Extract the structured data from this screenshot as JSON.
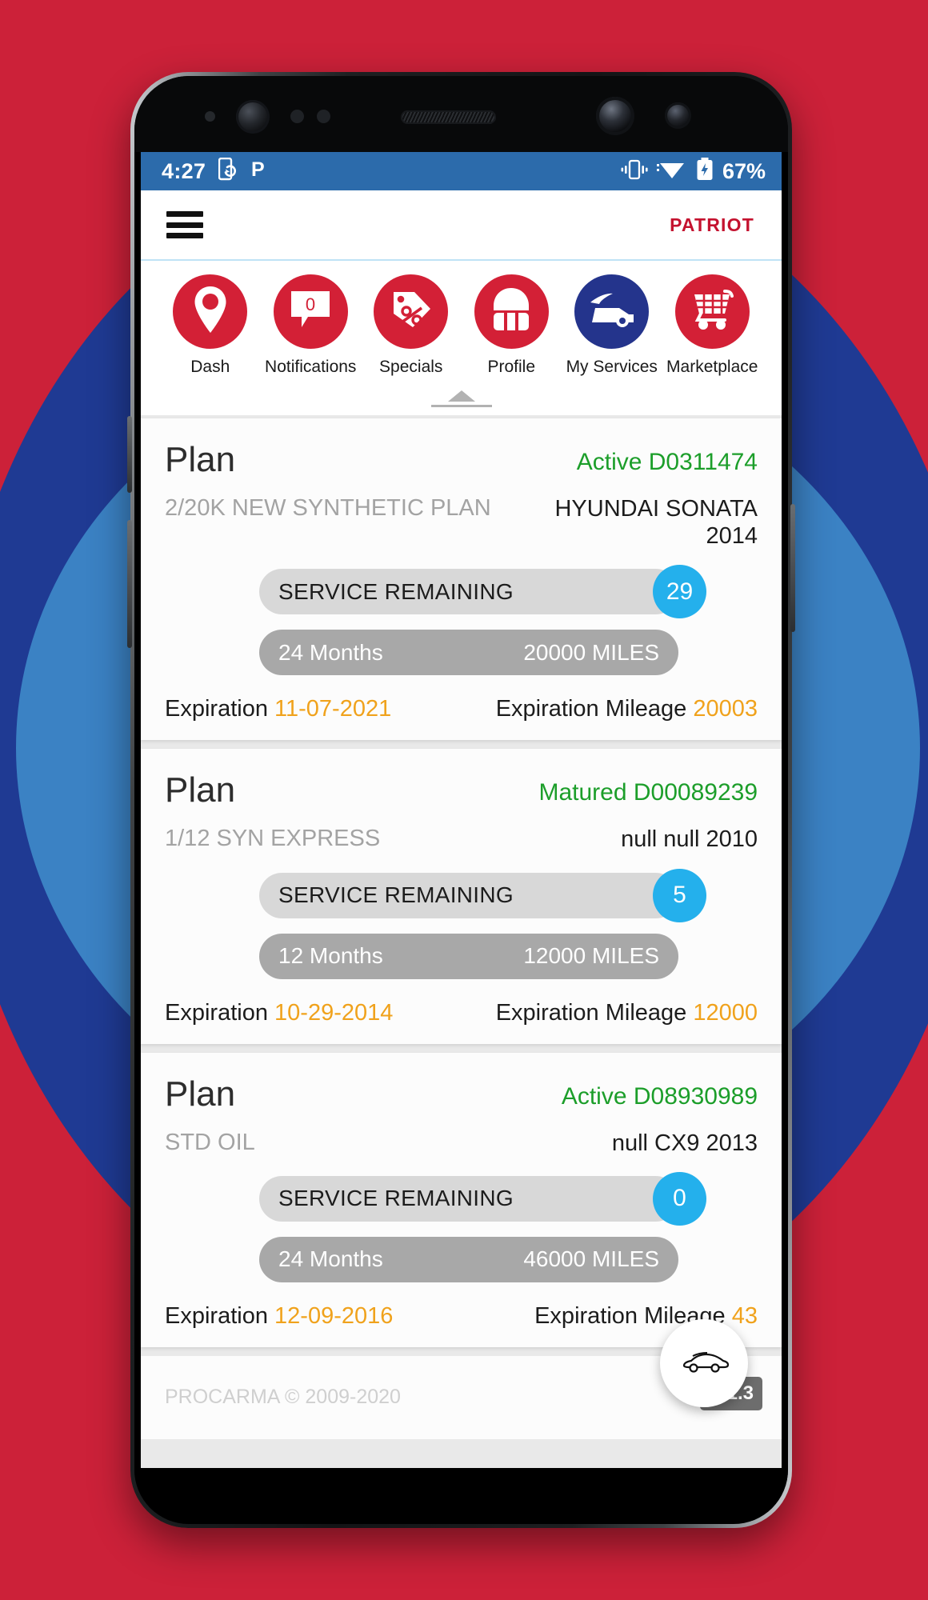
{
  "status_bar": {
    "time": "4:27",
    "left_icons": [
      "phone-sync-icon",
      "parking-p-icon"
    ],
    "right_icons": [
      "vibrate-icon",
      "wifi-icon",
      "battery-charging-icon"
    ],
    "battery_percent": "67%",
    "background_color": "#2c6bab"
  },
  "app_bar": {
    "menu_icon": "hamburger-menu-icon",
    "brand": "PATRIOT",
    "brand_color": "#c4122f"
  },
  "icon_nav": {
    "items": [
      {
        "label": "Dash",
        "icon": "location-pin-icon",
        "color": "#d32036",
        "badge": null
      },
      {
        "label": "Notifications",
        "icon": "speech-bubble-icon",
        "color": "#d32036",
        "badge": "0"
      },
      {
        "label": "Specials",
        "icon": "price-tag-percent-icon",
        "color": "#d32036",
        "badge": null
      },
      {
        "label": "Profile",
        "icon": "helmet-icon",
        "color": "#d32036",
        "badge": null
      },
      {
        "label": "My Services",
        "icon": "car-hood-open-icon",
        "color": "#24348c",
        "badge": null
      },
      {
        "label": "Marketplace",
        "icon": "shopping-cart-icon",
        "color": "#d32036",
        "badge": null
      }
    ],
    "collapse_icon": "collapse-up-handle-icon"
  },
  "labels": {
    "plan_title": "Plan",
    "service_remaining": "SERVICE REMAINING",
    "expiration": "Expiration",
    "expiration_mileage": "Expiration Mileage"
  },
  "plans": [
    {
      "title": "Plan",
      "status": "Active D0311474",
      "status_color": "#1c9e2a",
      "plan_name": "2/20K NEW SYNTHETIC PLAN",
      "vehicle": "HYUNDAI SONATA 2014",
      "service_remaining_label": "SERVICE REMAINING",
      "service_remaining_count": "29",
      "term_months": "24 Months",
      "term_miles": "20000 MILES",
      "expiration_label": "Expiration",
      "expiration_date": "11-07-2021",
      "expiration_mileage_label": "Expiration Mileage",
      "expiration_mileage": "20003"
    },
    {
      "title": "Plan",
      "status": "Matured D00089239",
      "status_color": "#1c9e2a",
      "plan_name": "1/12 SYN EXPRESS",
      "vehicle": "null null 2010",
      "service_remaining_label": "SERVICE REMAINING",
      "service_remaining_count": "5",
      "term_months": "12 Months",
      "term_miles": "12000 MILES",
      "expiration_label": "Expiration",
      "expiration_date": "10-29-2014",
      "expiration_mileage_label": "Expiration Mileage",
      "expiration_mileage": "12000"
    },
    {
      "title": "Plan",
      "status": "Active D08930989",
      "status_color": "#1c9e2a",
      "plan_name": "STD OIL",
      "vehicle": "null CX9 2013",
      "service_remaining_label": "SERVICE REMAINING",
      "service_remaining_count": "0",
      "term_months": "24 Months",
      "term_miles": "46000 MILES",
      "expiration_label": "Expiration",
      "expiration_date": "12-09-2016",
      "expiration_mileage_label": "Expiration Mileage",
      "expiration_mileage": "43"
    }
  ],
  "fab": {
    "icon": "car-icon"
  },
  "footer": {
    "copyright": "PROCARMA © 2009-2020",
    "version": "V 1.3"
  },
  "theme": {
    "poster_red": "#cc2139",
    "poster_navy": "#1f3a93",
    "poster_blue": "#3b82c4",
    "badge_blue": "#24b0ec",
    "accent_orange": "#f0a21c"
  }
}
